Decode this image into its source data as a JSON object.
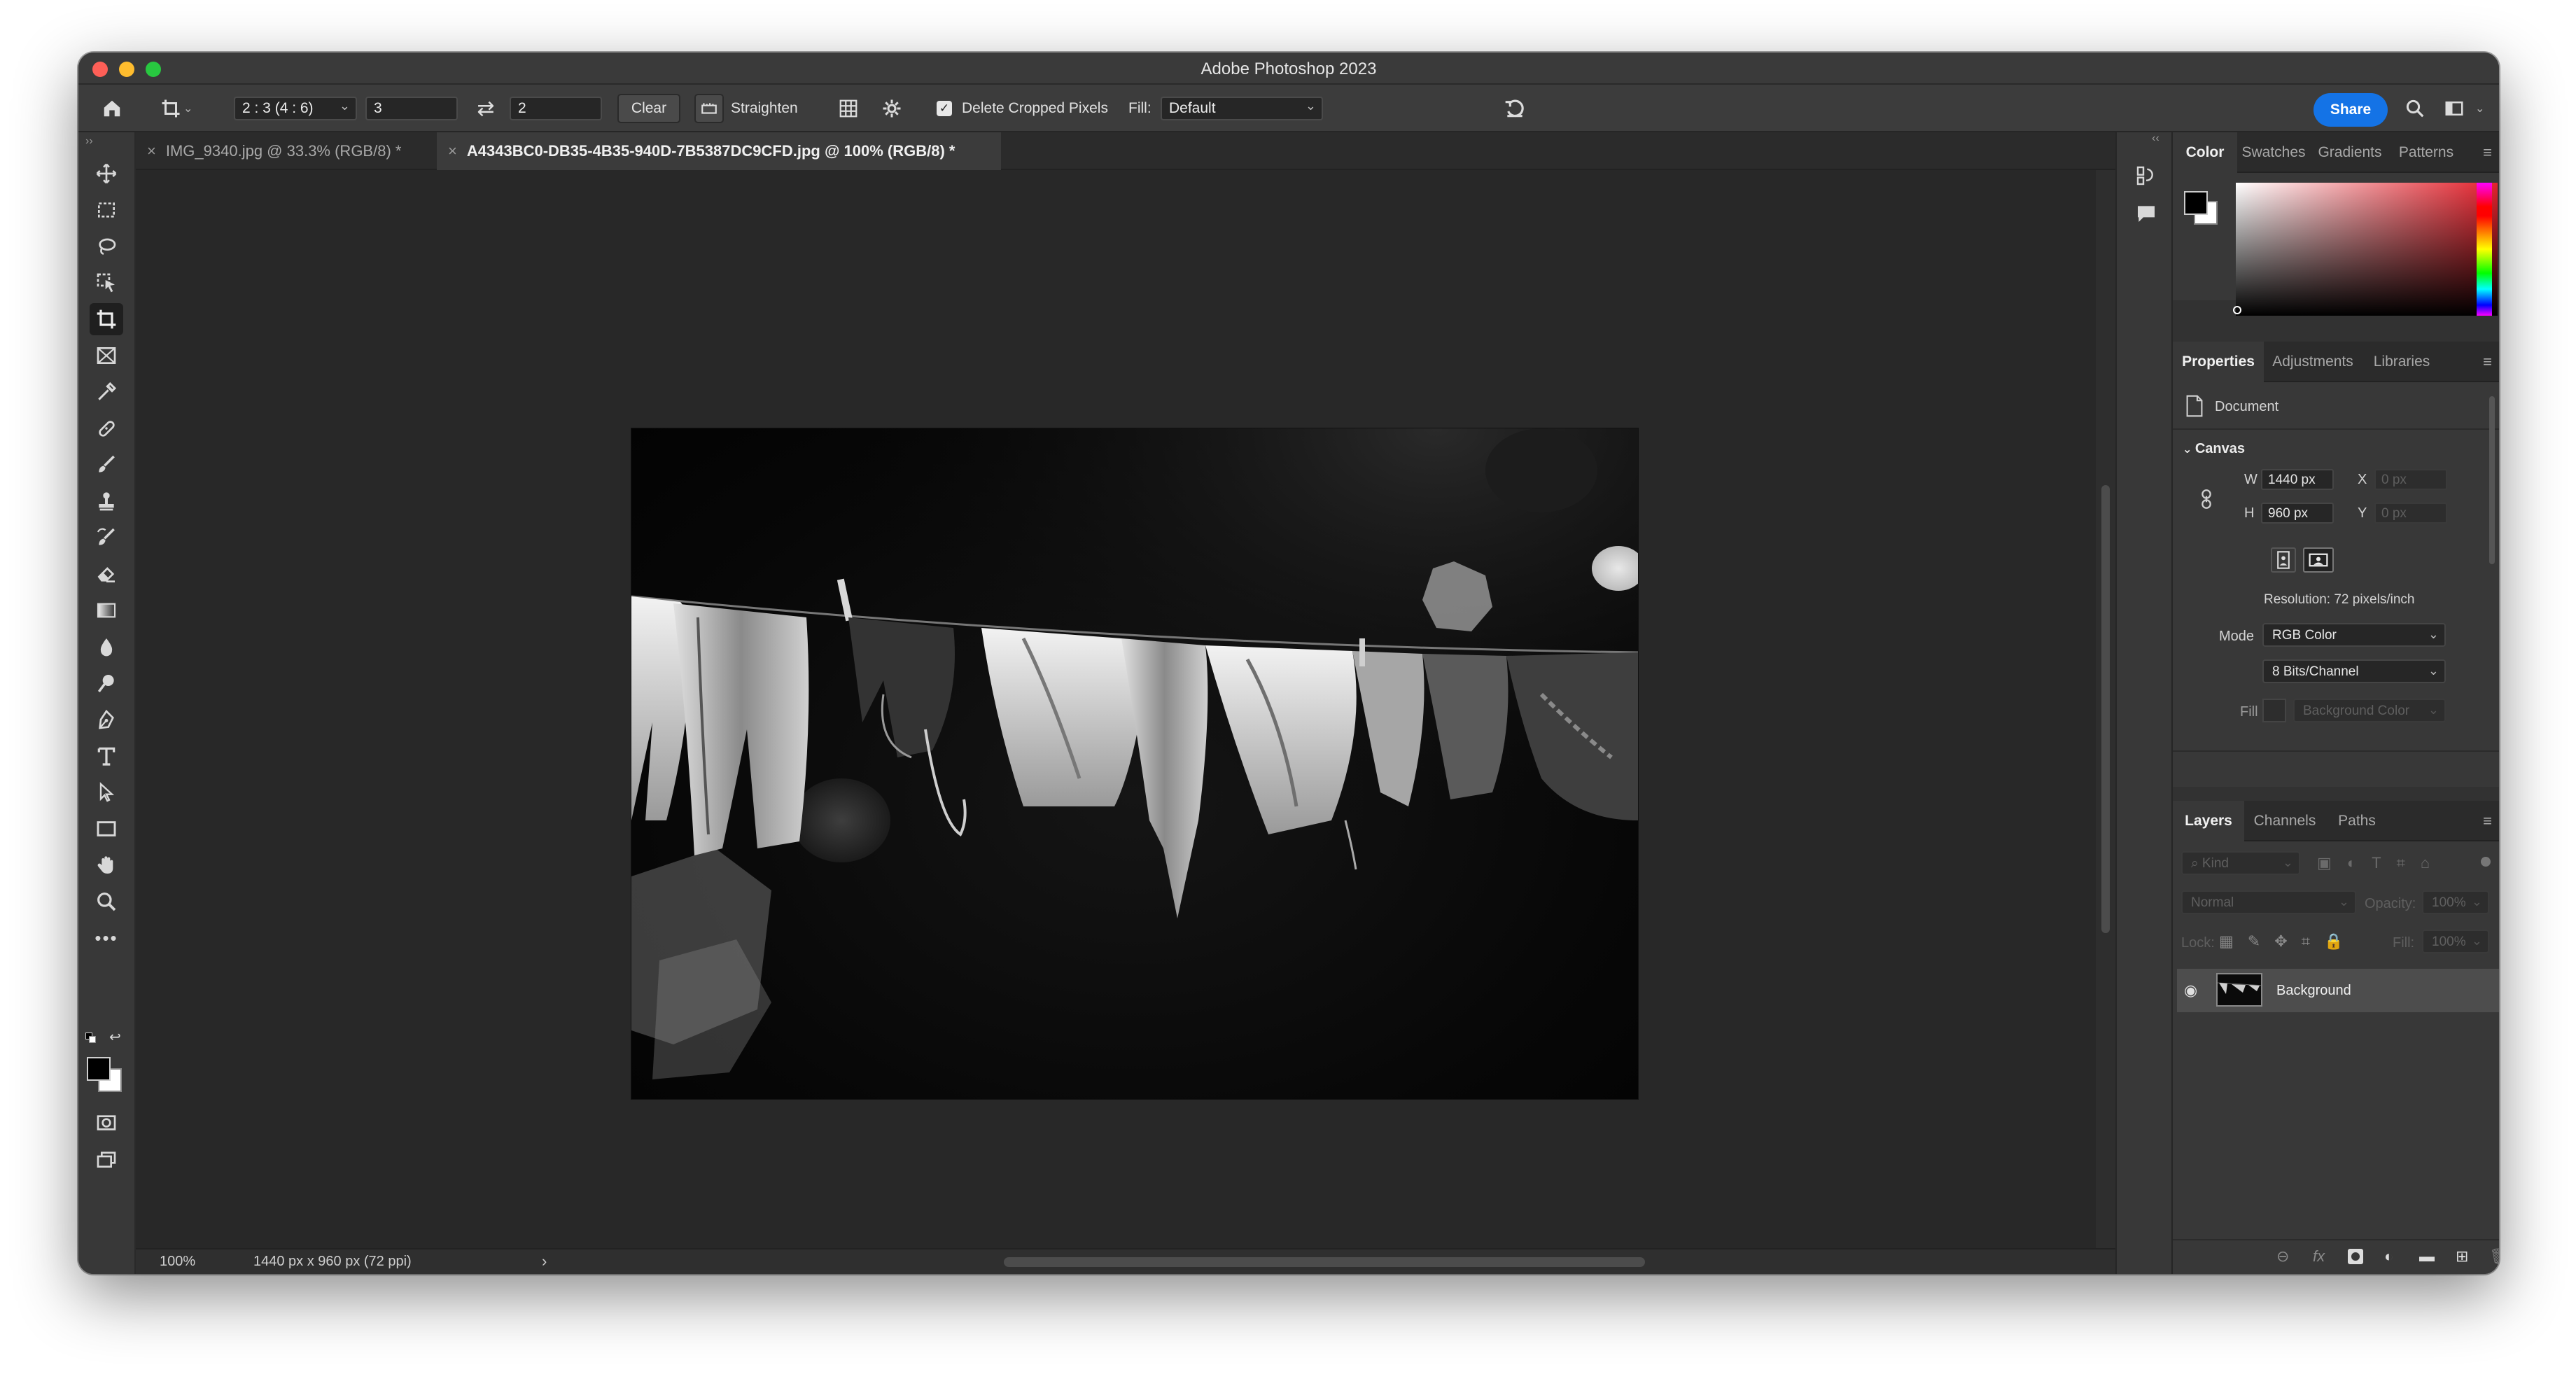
{
  "window": {
    "title": "Adobe Photoshop 2023"
  },
  "options_bar": {
    "ratio_preset": "2 : 3 (4 : 6)",
    "ratio_width": "3",
    "ratio_height": "2",
    "clear_label": "Clear",
    "straighten_label": "Straighten",
    "delete_cropped_label": "Delete Cropped Pixels",
    "delete_cropped_checked": true,
    "fill_label": "Fill:",
    "fill_value": "Default",
    "share_label": "Share",
    "accent_color": "#1473e6"
  },
  "tabs": [
    {
      "label": "IMG_9340.jpg @ 33.3% (RGB/8) *",
      "active": false
    },
    {
      "label": "A4343BC0-DB35-4B35-940D-7B5387DC9CFD.jpg @ 100% (RGB/8) *",
      "active": true
    }
  ],
  "status": {
    "zoom": "100%",
    "doc_info": "1440 px x 960 px (72 ppi)"
  },
  "color_panel": {
    "tabs": [
      "Color",
      "Swatches",
      "Gradients",
      "Patterns"
    ],
    "active_tab": "Color",
    "foreground": "#000000",
    "background": "#ffffff",
    "hue_color": "#e4222c"
  },
  "properties_panel": {
    "tabs": [
      "Properties",
      "Adjustments",
      "Libraries"
    ],
    "active_tab": "Properties",
    "document_label": "Document",
    "canvas_section": "Canvas",
    "w_label": "W",
    "w_value": "1440 px",
    "h_label": "H",
    "h_value": "960 px",
    "x_label": "X",
    "x_placeholder": "0 px",
    "y_label": "Y",
    "y_placeholder": "0 px",
    "resolution": "Resolution: 72 pixels/inch",
    "mode_label": "Mode",
    "mode_value": "RGB Color",
    "bits_value": "8 Bits/Channel",
    "fill_label": "Fill",
    "fill_value": "Background Color"
  },
  "layers_panel": {
    "tabs": [
      "Layers",
      "Channels",
      "Paths"
    ],
    "active_tab": "Layers",
    "kind_placeholder": "Kind",
    "blend_mode": "Normal",
    "opacity_label": "Opacity:",
    "opacity_value": "100%",
    "lock_label": "Lock:",
    "fill_label": "Fill:",
    "fill_value": "100%",
    "layers": [
      {
        "name": "Background",
        "visible": true,
        "locked": true
      }
    ]
  },
  "tools": [
    "move-tool",
    "marquee-tool",
    "lasso-tool",
    "object-selection-tool",
    "crop-tool",
    "frame-tool",
    "eyedropper-tool",
    "healing-brush-tool",
    "brush-tool",
    "clone-stamp-tool",
    "history-brush-tool",
    "eraser-tool",
    "gradient-tool",
    "blur-tool",
    "dodge-tool",
    "pen-tool",
    "type-tool",
    "path-selection-tool",
    "rectangle-tool",
    "hand-tool",
    "zoom-tool",
    "more-tools"
  ]
}
